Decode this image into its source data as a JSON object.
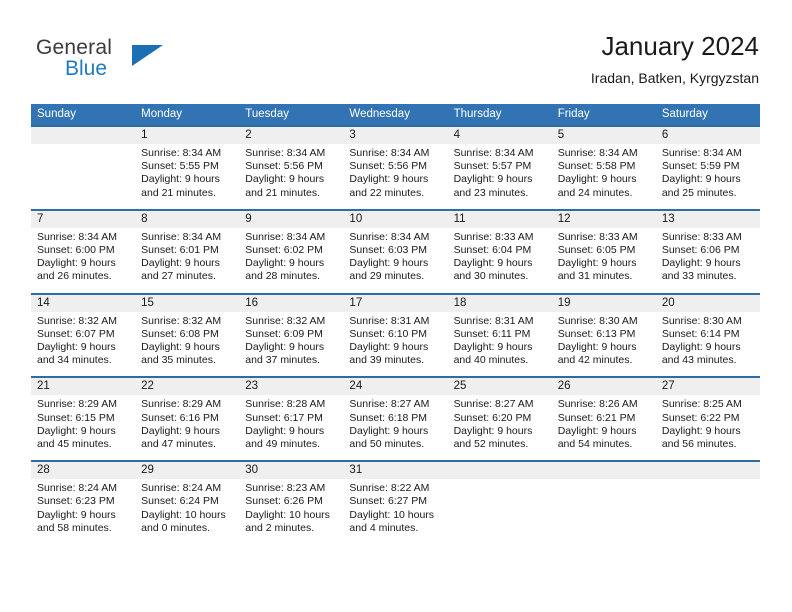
{
  "brand": {
    "name_part1": "General",
    "name_part2": "Blue",
    "accent_color": "#1a6fb5"
  },
  "header": {
    "title": "January 2024",
    "subtitle": "Iradan, Batken, Kyrgyzstan",
    "header_bg_color": "#3274b3",
    "row_border_color": "#2e6da4",
    "day_band_color": "#efefef"
  },
  "weekdays": [
    "Sunday",
    "Monday",
    "Tuesday",
    "Wednesday",
    "Thursday",
    "Friday",
    "Saturday"
  ],
  "weeks": [
    [
      {
        "day": "",
        "empty": true,
        "sunrise": "",
        "sunset": "",
        "daylight1": "",
        "daylight2": ""
      },
      {
        "day": "1",
        "sunrise": "Sunrise: 8:34 AM",
        "sunset": "Sunset: 5:55 PM",
        "daylight1": "Daylight: 9 hours",
        "daylight2": "and 21 minutes."
      },
      {
        "day": "2",
        "sunrise": "Sunrise: 8:34 AM",
        "sunset": "Sunset: 5:56 PM",
        "daylight1": "Daylight: 9 hours",
        "daylight2": "and 21 minutes."
      },
      {
        "day": "3",
        "sunrise": "Sunrise: 8:34 AM",
        "sunset": "Sunset: 5:56 PM",
        "daylight1": "Daylight: 9 hours",
        "daylight2": "and 22 minutes."
      },
      {
        "day": "4",
        "sunrise": "Sunrise: 8:34 AM",
        "sunset": "Sunset: 5:57 PM",
        "daylight1": "Daylight: 9 hours",
        "daylight2": "and 23 minutes."
      },
      {
        "day": "5",
        "sunrise": "Sunrise: 8:34 AM",
        "sunset": "Sunset: 5:58 PM",
        "daylight1": "Daylight: 9 hours",
        "daylight2": "and 24 minutes."
      },
      {
        "day": "6",
        "sunrise": "Sunrise: 8:34 AM",
        "sunset": "Sunset: 5:59 PM",
        "daylight1": "Daylight: 9 hours",
        "daylight2": "and 25 minutes."
      }
    ],
    [
      {
        "day": "7",
        "sunrise": "Sunrise: 8:34 AM",
        "sunset": "Sunset: 6:00 PM",
        "daylight1": "Daylight: 9 hours",
        "daylight2": "and 26 minutes."
      },
      {
        "day": "8",
        "sunrise": "Sunrise: 8:34 AM",
        "sunset": "Sunset: 6:01 PM",
        "daylight1": "Daylight: 9 hours",
        "daylight2": "and 27 minutes."
      },
      {
        "day": "9",
        "sunrise": "Sunrise: 8:34 AM",
        "sunset": "Sunset: 6:02 PM",
        "daylight1": "Daylight: 9 hours",
        "daylight2": "and 28 minutes."
      },
      {
        "day": "10",
        "sunrise": "Sunrise: 8:34 AM",
        "sunset": "Sunset: 6:03 PM",
        "daylight1": "Daylight: 9 hours",
        "daylight2": "and 29 minutes."
      },
      {
        "day": "11",
        "sunrise": "Sunrise: 8:33 AM",
        "sunset": "Sunset: 6:04 PM",
        "daylight1": "Daylight: 9 hours",
        "daylight2": "and 30 minutes."
      },
      {
        "day": "12",
        "sunrise": "Sunrise: 8:33 AM",
        "sunset": "Sunset: 6:05 PM",
        "daylight1": "Daylight: 9 hours",
        "daylight2": "and 31 minutes."
      },
      {
        "day": "13",
        "sunrise": "Sunrise: 8:33 AM",
        "sunset": "Sunset: 6:06 PM",
        "daylight1": "Daylight: 9 hours",
        "daylight2": "and 33 minutes."
      }
    ],
    [
      {
        "day": "14",
        "sunrise": "Sunrise: 8:32 AM",
        "sunset": "Sunset: 6:07 PM",
        "daylight1": "Daylight: 9 hours",
        "daylight2": "and 34 minutes."
      },
      {
        "day": "15",
        "sunrise": "Sunrise: 8:32 AM",
        "sunset": "Sunset: 6:08 PM",
        "daylight1": "Daylight: 9 hours",
        "daylight2": "and 35 minutes."
      },
      {
        "day": "16",
        "sunrise": "Sunrise: 8:32 AM",
        "sunset": "Sunset: 6:09 PM",
        "daylight1": "Daylight: 9 hours",
        "daylight2": "and 37 minutes."
      },
      {
        "day": "17",
        "sunrise": "Sunrise: 8:31 AM",
        "sunset": "Sunset: 6:10 PM",
        "daylight1": "Daylight: 9 hours",
        "daylight2": "and 39 minutes."
      },
      {
        "day": "18",
        "sunrise": "Sunrise: 8:31 AM",
        "sunset": "Sunset: 6:11 PM",
        "daylight1": "Daylight: 9 hours",
        "daylight2": "and 40 minutes."
      },
      {
        "day": "19",
        "sunrise": "Sunrise: 8:30 AM",
        "sunset": "Sunset: 6:13 PM",
        "daylight1": "Daylight: 9 hours",
        "daylight2": "and 42 minutes."
      },
      {
        "day": "20",
        "sunrise": "Sunrise: 8:30 AM",
        "sunset": "Sunset: 6:14 PM",
        "daylight1": "Daylight: 9 hours",
        "daylight2": "and 43 minutes."
      }
    ],
    [
      {
        "day": "21",
        "sunrise": "Sunrise: 8:29 AM",
        "sunset": "Sunset: 6:15 PM",
        "daylight1": "Daylight: 9 hours",
        "daylight2": "and 45 minutes."
      },
      {
        "day": "22",
        "sunrise": "Sunrise: 8:29 AM",
        "sunset": "Sunset: 6:16 PM",
        "daylight1": "Daylight: 9 hours",
        "daylight2": "and 47 minutes."
      },
      {
        "day": "23",
        "sunrise": "Sunrise: 8:28 AM",
        "sunset": "Sunset: 6:17 PM",
        "daylight1": "Daylight: 9 hours",
        "daylight2": "and 49 minutes."
      },
      {
        "day": "24",
        "sunrise": "Sunrise: 8:27 AM",
        "sunset": "Sunset: 6:18 PM",
        "daylight1": "Daylight: 9 hours",
        "daylight2": "and 50 minutes."
      },
      {
        "day": "25",
        "sunrise": "Sunrise: 8:27 AM",
        "sunset": "Sunset: 6:20 PM",
        "daylight1": "Daylight: 9 hours",
        "daylight2": "and 52 minutes."
      },
      {
        "day": "26",
        "sunrise": "Sunrise: 8:26 AM",
        "sunset": "Sunset: 6:21 PM",
        "daylight1": "Daylight: 9 hours",
        "daylight2": "and 54 minutes."
      },
      {
        "day": "27",
        "sunrise": "Sunrise: 8:25 AM",
        "sunset": "Sunset: 6:22 PM",
        "daylight1": "Daylight: 9 hours",
        "daylight2": "and 56 minutes."
      }
    ],
    [
      {
        "day": "28",
        "sunrise": "Sunrise: 8:24 AM",
        "sunset": "Sunset: 6:23 PM",
        "daylight1": "Daylight: 9 hours",
        "daylight2": "and 58 minutes."
      },
      {
        "day": "29",
        "sunrise": "Sunrise: 8:24 AM",
        "sunset": "Sunset: 6:24 PM",
        "daylight1": "Daylight: 10 hours",
        "daylight2": "and 0 minutes."
      },
      {
        "day": "30",
        "sunrise": "Sunrise: 8:23 AM",
        "sunset": "Sunset: 6:26 PM",
        "daylight1": "Daylight: 10 hours",
        "daylight2": "and 2 minutes."
      },
      {
        "day": "31",
        "sunrise": "Sunrise: 8:22 AM",
        "sunset": "Sunset: 6:27 PM",
        "daylight1": "Daylight: 10 hours",
        "daylight2": "and 4 minutes."
      },
      {
        "day": "",
        "empty": true,
        "sunrise": "",
        "sunset": "",
        "daylight1": "",
        "daylight2": ""
      },
      {
        "day": "",
        "empty": true,
        "sunrise": "",
        "sunset": "",
        "daylight1": "",
        "daylight2": ""
      },
      {
        "day": "",
        "empty": true,
        "sunrise": "",
        "sunset": "",
        "daylight1": "",
        "daylight2": ""
      }
    ]
  ]
}
